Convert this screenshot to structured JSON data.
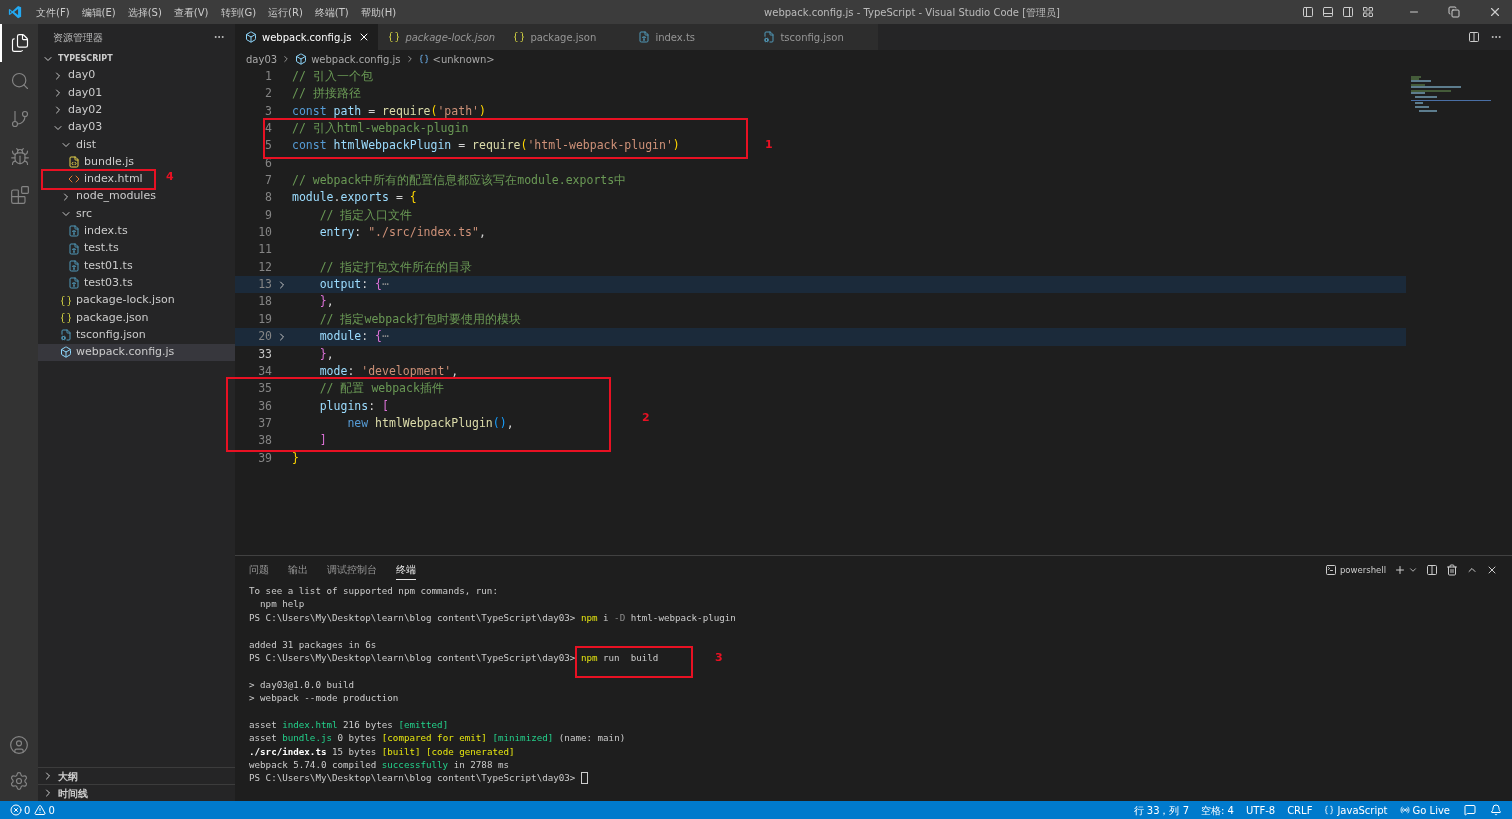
{
  "title_bar": {
    "menu": [
      "文件(F)",
      "编辑(E)",
      "选择(S)",
      "查看(V)",
      "转到(G)",
      "运行(R)",
      "终端(T)",
      "帮助(H)"
    ],
    "title": "webpack.config.js - TypeScript - Visual Studio Code [管理员]"
  },
  "activity_bar": [
    {
      "kind": "files",
      "selected": true
    },
    {
      "kind": "search",
      "selected": false
    },
    {
      "kind": "scm",
      "selected": false
    },
    {
      "kind": "debug",
      "selected": false
    },
    {
      "kind": "extensions",
      "selected": false
    }
  ],
  "sidebar": {
    "title": "资源管理器",
    "section": "TYPESCRIPT",
    "tree": [
      {
        "name": "day0",
        "kind": "folder",
        "expanded": false,
        "selected": false
      },
      {
        "name": "day01",
        "kind": "folder",
        "expanded": false,
        "selected": false
      },
      {
        "name": "day02",
        "kind": "folder",
        "expanded": false,
        "selected": false
      },
      {
        "name": "day03",
        "kind": "folder",
        "expanded": true,
        "selected": false,
        "children": [
          {
            "name": "dist",
            "kind": "folder",
            "expanded": true,
            "selected": false,
            "children": [
              {
                "name": "bundle.js",
                "kind": "js",
                "selected": false
              },
              {
                "name": "index.html",
                "kind": "html",
                "selected": false
              }
            ]
          },
          {
            "name": "node_modules",
            "kind": "folder",
            "expanded": false,
            "selected": false
          },
          {
            "name": "src",
            "kind": "folder",
            "expanded": true,
            "selected": false,
            "children": [
              {
                "name": "index.ts",
                "kind": "ts",
                "selected": false
              },
              {
                "name": "test.ts",
                "kind": "ts",
                "selected": false
              },
              {
                "name": "test01.ts",
                "kind": "ts",
                "selected": false
              },
              {
                "name": "test03.ts",
                "kind": "ts",
                "selected": false
              }
            ]
          },
          {
            "name": "package-lock.json",
            "kind": "json",
            "selected": false
          },
          {
            "name": "package.json",
            "kind": "json",
            "selected": false
          },
          {
            "name": "tsconfig.json",
            "kind": "tsconfig",
            "selected": false
          },
          {
            "name": "webpack.config.js",
            "kind": "webpack",
            "selected": true
          }
        ]
      }
    ],
    "bottom_sections": [
      "大纲",
      "时间线"
    ]
  },
  "editor": {
    "tabs": [
      {
        "label": "webpack.config.js",
        "kind": "webpack",
        "selected": true,
        "preview": false
      },
      {
        "label": "package-lock.json",
        "kind": "json",
        "selected": false,
        "preview": true
      },
      {
        "label": "package.json",
        "kind": "json",
        "selected": false,
        "preview": false
      },
      {
        "label": "index.ts",
        "kind": "ts",
        "selected": false,
        "preview": false
      },
      {
        "label": "tsconfig.json",
        "kind": "tsconfig",
        "selected": false,
        "preview": false
      }
    ],
    "breadcrumb": [
      "day03",
      "webpack.config.js",
      "<unknown>"
    ],
    "lines": [
      {
        "number": "1",
        "folded": false,
        "current": false,
        "tokens": [
          {
            "kind": "comment",
            "text": "// 引入一个包"
          }
        ]
      },
      {
        "number": "2",
        "folded": false,
        "current": false,
        "tokens": [
          {
            "kind": "comment",
            "text": "// 拼接路径"
          }
        ]
      },
      {
        "number": "3",
        "folded": false,
        "current": false,
        "tokens": [
          {
            "kind": "keyword",
            "text": "const "
          },
          {
            "kind": "variable",
            "text": "path"
          },
          {
            "kind": "plain",
            "text": " = "
          },
          {
            "kind": "function",
            "text": "require"
          },
          {
            "kind": "bracket",
            "text": "("
          },
          {
            "kind": "string",
            "text": "'path'"
          },
          {
            "kind": "bracket",
            "text": ")"
          }
        ]
      },
      {
        "number": "4",
        "folded": false,
        "current": false,
        "tokens": [
          {
            "kind": "comment",
            "text": "// 引入html-webpack-plugin"
          }
        ]
      },
      {
        "number": "5",
        "folded": false,
        "current": false,
        "tokens": [
          {
            "kind": "keyword",
            "text": "const "
          },
          {
            "kind": "variable",
            "text": "htmlWebpackPlugin"
          },
          {
            "kind": "plain",
            "text": " = "
          },
          {
            "kind": "function",
            "text": "require"
          },
          {
            "kind": "bracket",
            "text": "("
          },
          {
            "kind": "string",
            "text": "'html-webpack-plugin'"
          },
          {
            "kind": "bracket",
            "text": ")"
          }
        ]
      },
      {
        "number": "6",
        "folded": false,
        "current": false
      },
      {
        "number": "7",
        "folded": false,
        "current": false,
        "tokens": [
          {
            "kind": "comment",
            "text": "// webpack中所有的配置信息都应该写在module.exports中"
          }
        ]
      },
      {
        "number": "8",
        "folded": false,
        "current": false,
        "tokens": [
          {
            "kind": "variable",
            "text": "module"
          },
          {
            "kind": "plain",
            "text": "."
          },
          {
            "kind": "variable",
            "text": "exports"
          },
          {
            "kind": "plain",
            "text": " = "
          },
          {
            "kind": "bracket",
            "text": "{"
          }
        ]
      },
      {
        "number": "9",
        "folded": false,
        "current": false,
        "tokens": [
          {
            "kind": "comment",
            "text": "    // 指定入口文件"
          }
        ]
      },
      {
        "number": "10",
        "folded": false,
        "current": false,
        "tokens": [
          {
            "kind": "variable",
            "text": "    entry"
          },
          {
            "kind": "plain",
            "text": ": "
          },
          {
            "kind": "string",
            "text": "\"./src/index.ts\""
          },
          {
            "kind": "plain",
            "text": ","
          }
        ]
      },
      {
        "number": "11",
        "folded": false,
        "current": false
      },
      {
        "number": "12",
        "folded": false,
        "current": false,
        "tokens": [
          {
            "kind": "comment",
            "text": "    // 指定打包文件所在的目录"
          }
        ]
      },
      {
        "number": "13",
        "folded": true,
        "current": false,
        "tokens": [
          {
            "kind": "variable",
            "text": "    output"
          },
          {
            "kind": "plain",
            "text": ": "
          },
          {
            "kind": "bracket2",
            "text": "{"
          },
          {
            "kind": "fold",
            "text": "⋯"
          }
        ]
      },
      {
        "number": "18",
        "folded": false,
        "current": false,
        "tokens": [
          {
            "kind": "bracket2",
            "text": "    }"
          },
          {
            "kind": "plain",
            "text": ","
          }
        ]
      },
      {
        "number": "19",
        "folded": false,
        "current": false,
        "tokens": [
          {
            "kind": "comment",
            "text": "    // 指定webpack打包时要使用的模块"
          }
        ]
      },
      {
        "number": "20",
        "folded": true,
        "current": false,
        "tokens": [
          {
            "kind": "variable",
            "text": "    module"
          },
          {
            "kind": "plain",
            "text": ": "
          },
          {
            "kind": "bracket2",
            "text": "{"
          },
          {
            "kind": "fold",
            "text": "⋯"
          }
        ]
      },
      {
        "number": "33",
        "folded": false,
        "current": true,
        "tokens": [
          {
            "kind": "bracket2",
            "text": "    }"
          },
          {
            "kind": "plain",
            "text": ","
          }
        ]
      },
      {
        "number": "34",
        "folded": false,
        "current": false,
        "tokens": [
          {
            "kind": "variable",
            "text": "    mode"
          },
          {
            "kind": "plain",
            "text": ": "
          },
          {
            "kind": "string",
            "text": "'development'"
          },
          {
            "kind": "plain",
            "text": ","
          }
        ]
      },
      {
        "number": "35",
        "folded": false,
        "current": false,
        "tokens": [
          {
            "kind": "comment",
            "text": "    // 配置 webpack插件"
          }
        ]
      },
      {
        "number": "36",
        "folded": false,
        "current": false,
        "tokens": [
          {
            "kind": "variable",
            "text": "    plugins"
          },
          {
            "kind": "plain",
            "text": ": "
          },
          {
            "kind": "bracket2",
            "text": "["
          }
        ]
      },
      {
        "number": "37",
        "folded": false,
        "current": false,
        "tokens": [
          {
            "kind": "keyword",
            "text": "        new "
          },
          {
            "kind": "function",
            "text": "htmlWebpackPlugin"
          },
          {
            "kind": "bracket3",
            "text": "()"
          },
          {
            "kind": "plain",
            "text": ","
          }
        ]
      },
      {
        "number": "38",
        "folded": false,
        "current": false,
        "tokens": [
          {
            "kind": "bracket2",
            "text": "    ]"
          }
        ]
      },
      {
        "number": "39",
        "folded": false,
        "current": false,
        "tokens": [
          {
            "kind": "bracket",
            "text": "}"
          }
        ]
      }
    ]
  },
  "panel": {
    "tabs": [
      {
        "label": "问题",
        "selected": false
      },
      {
        "label": "输出",
        "selected": false
      },
      {
        "label": "调试控制台",
        "selected": false
      },
      {
        "label": "终端",
        "selected": true
      }
    ],
    "shell": "powershell",
    "lines": [
      {
        "tokens": [
          {
            "kind": "plain",
            "text": "To see a list of supported npm commands, run:"
          }
        ]
      },
      {
        "tokens": [
          {
            "kind": "plain",
            "text": "  npm help"
          }
        ]
      },
      {
        "tokens": [
          {
            "kind": "plain",
            "text": "PS C:\\Users\\My\\Desktop\\learn\\blog content\\TypeScript\\day03> "
          },
          {
            "kind": "yellow",
            "text": "npm"
          },
          {
            "kind": "plain",
            "text": " i "
          },
          {
            "kind": "dim",
            "text": "-D"
          },
          {
            "kind": "plain",
            "text": " html-webpack-plugin"
          }
        ]
      },
      {
        "blank_before": true,
        "tokens": [
          {
            "kind": "plain",
            "text": "added 31 packages in 6s"
          }
        ]
      },
      {
        "tokens": [
          {
            "kind": "plain",
            "text": "PS C:\\Users\\My\\Desktop\\learn\\blog content\\TypeScript\\day03> "
          },
          {
            "kind": "yellow",
            "text": "npm"
          },
          {
            "kind": "plain",
            "text": " run  build"
          }
        ]
      },
      {
        "blank_before": true,
        "tokens": [
          {
            "kind": "plain",
            "text": "> day03@1.0.0 build"
          }
        ]
      },
      {
        "tokens": [
          {
            "kind": "plain",
            "text": "> webpack --mode production"
          }
        ]
      },
      {
        "blank_before": true,
        "tokens": [
          {
            "kind": "plain",
            "text": "asset "
          },
          {
            "kind": "green",
            "text": "index.html"
          },
          {
            "kind": "plain",
            "text": " 216 bytes "
          },
          {
            "kind": "green",
            "text": "[emitted]"
          }
        ]
      },
      {
        "tokens": [
          {
            "kind": "plain",
            "text": "asset "
          },
          {
            "kind": "green",
            "text": "bundle.js"
          },
          {
            "kind": "plain",
            "text": " 0 bytes "
          },
          {
            "kind": "yellow",
            "text": "[compared for emit]"
          },
          {
            "kind": "green",
            "text": " [minimized]"
          },
          {
            "kind": "plain",
            "text": " (name: main)"
          }
        ]
      },
      {
        "tokens": [
          {
            "kind": "bold",
            "text": "./src/index.ts"
          },
          {
            "kind": "plain",
            "text": " 15 bytes "
          },
          {
            "kind": "yellow",
            "text": "[built] [code generated]"
          }
        ]
      },
      {
        "tokens": [
          {
            "kind": "plain",
            "text": "webpack 5.74.0 compiled "
          },
          {
            "kind": "green",
            "text": "successfully"
          },
          {
            "kind": "plain",
            "text": " in 2788 ms"
          }
        ]
      },
      {
        "cursor": true,
        "tokens": [
          {
            "kind": "plain",
            "text": "PS C:\\Users\\My\\Desktop\\learn\\blog content\\TypeScript\\day03> "
          }
        ]
      }
    ]
  },
  "annotations": [
    {
      "label": "1"
    },
    {
      "label": "2"
    },
    {
      "label": "3"
    },
    {
      "label": "4"
    }
  ],
  "status_bar": {
    "errors": "0",
    "warnings": "0",
    "items": [
      {
        "kind": "text",
        "text": "行 33，列 7"
      },
      {
        "kind": "text",
        "text": "空格: 4"
      },
      {
        "kind": "text",
        "text": "UTF-8"
      },
      {
        "kind": "text",
        "text": "CRLF"
      },
      {
        "kind": "language",
        "text": "JavaScript"
      },
      {
        "kind": "golive",
        "text": "Go Live"
      }
    ]
  }
}
